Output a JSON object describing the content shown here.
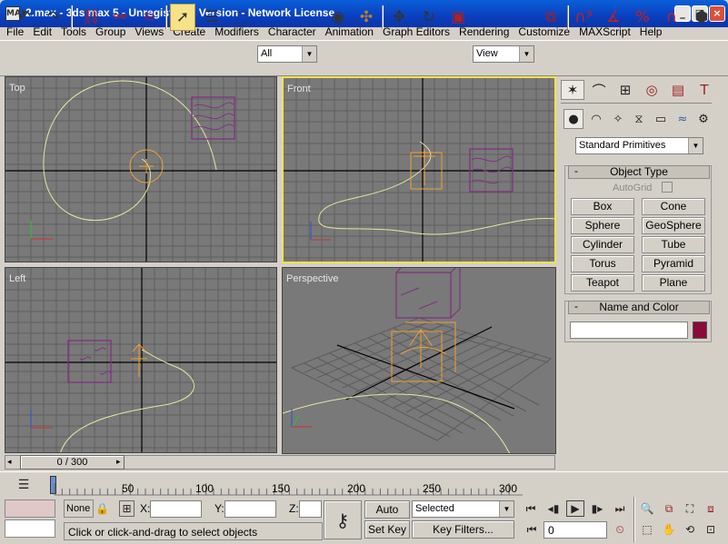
{
  "window": {
    "title": "2.max - 3ds max 5 - Unregistered Version - Network License",
    "app_icon": "MAX",
    "minimize_icon": "minimize-icon",
    "maximize_icon": "maximize-icon",
    "close_icon": "close-icon"
  },
  "menu": [
    "File",
    "Edit",
    "Tools",
    "Group",
    "Views",
    "Create",
    "Modifiers",
    "Character",
    "Animation",
    "Graph Editors",
    "Rendering",
    "Customize",
    "MAXScript",
    "Help"
  ],
  "toolbar": {
    "selection_filter": "All",
    "reference_coord": "View",
    "icons": [
      "undo-icon",
      "redo-icon",
      "select-and-link-icon",
      "unlink-icon",
      "bind-space-warp-icon",
      "select-object-icon",
      "select-by-name-icon",
      "rectangular-selection-icon",
      "window-crossing-icon",
      "select-move-icon",
      "select-rotate-icon",
      "select-scale-icon",
      "use-pivot-icon",
      "select-manipulate-icon",
      "snap-3d-icon",
      "angle-snap-icon",
      "percent-snap-icon",
      "spinner-snap-icon",
      "named-selection-icon",
      "mirror-icon",
      "align-icon",
      "material-editor-icon",
      "render-scene-icon",
      "quick-render-icon"
    ]
  },
  "viewports": {
    "top": "Top",
    "front": "Front",
    "left": "Left",
    "perspective": "Perspective"
  },
  "command_panel": {
    "tabs": [
      "create-tab-icon",
      "modify-tab-icon",
      "hierarchy-tab-icon",
      "motion-tab-icon",
      "display-tab-icon",
      "utilities-tab-icon"
    ],
    "categories": [
      "geometry-icon",
      "shapes-icon",
      "lights-icon",
      "cameras-icon",
      "helpers-icon",
      "space-warps-icon",
      "systems-icon"
    ],
    "dropdown": "Standard Primitives",
    "object_type": {
      "header": "Object Type",
      "minus": "-",
      "autogrid": "AutoGrid",
      "buttons": [
        "Box",
        "Cone",
        "Sphere",
        "GeoSphere",
        "Cylinder",
        "Tube",
        "Torus",
        "Pyramid",
        "Teapot",
        "Plane"
      ]
    },
    "name_color": {
      "header": "Name and Color",
      "minus": "-",
      "name_value": "",
      "color": "#8b0a3a"
    }
  },
  "timeline": {
    "slider": "0 / 300",
    "ticks": [
      "50",
      "100",
      "150",
      "200",
      "250",
      "300"
    ]
  },
  "status": {
    "selection": "None",
    "x_label": "X:",
    "y_label": "Y:",
    "z_label": "Z:",
    "x_value": "",
    "y_value": "",
    "z_value": "",
    "prompt": "Click or click-and-drag to select objects",
    "auto_key": "Auto Key",
    "set_key": "Set Key",
    "selected": "Selected",
    "key_filters": "Key Filters...",
    "frame": "0"
  }
}
